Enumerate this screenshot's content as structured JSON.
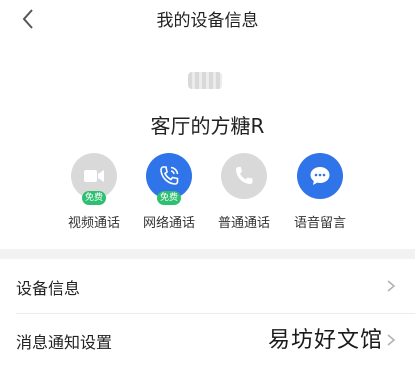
{
  "header": {
    "title": "我的设备信息",
    "back_icon": "chevron-left-icon"
  },
  "device": {
    "name": "客厅的方糖R"
  },
  "actions": [
    {
      "label": "视频通话",
      "badge": "免费",
      "icon": "video-camera-icon",
      "color": "#d9d9d9"
    },
    {
      "label": "网络通话",
      "badge": "免费",
      "icon": "phone-wifi-icon",
      "color": "#2f74e8"
    },
    {
      "label": "普通通话",
      "badge": "",
      "icon": "phone-icon",
      "color": "#d9d9d9"
    },
    {
      "label": "语音留言",
      "badge": "",
      "icon": "chat-bubble-icon",
      "color": "#2f74e8"
    }
  ],
  "menu": [
    {
      "label": "设备信息"
    },
    {
      "label": "消息通知设置"
    }
  ],
  "watermark": "易坊好文馆",
  "colors": {
    "accent": "#2f74e8",
    "badge": "#2fbf71",
    "inactive": "#d9d9d9"
  }
}
